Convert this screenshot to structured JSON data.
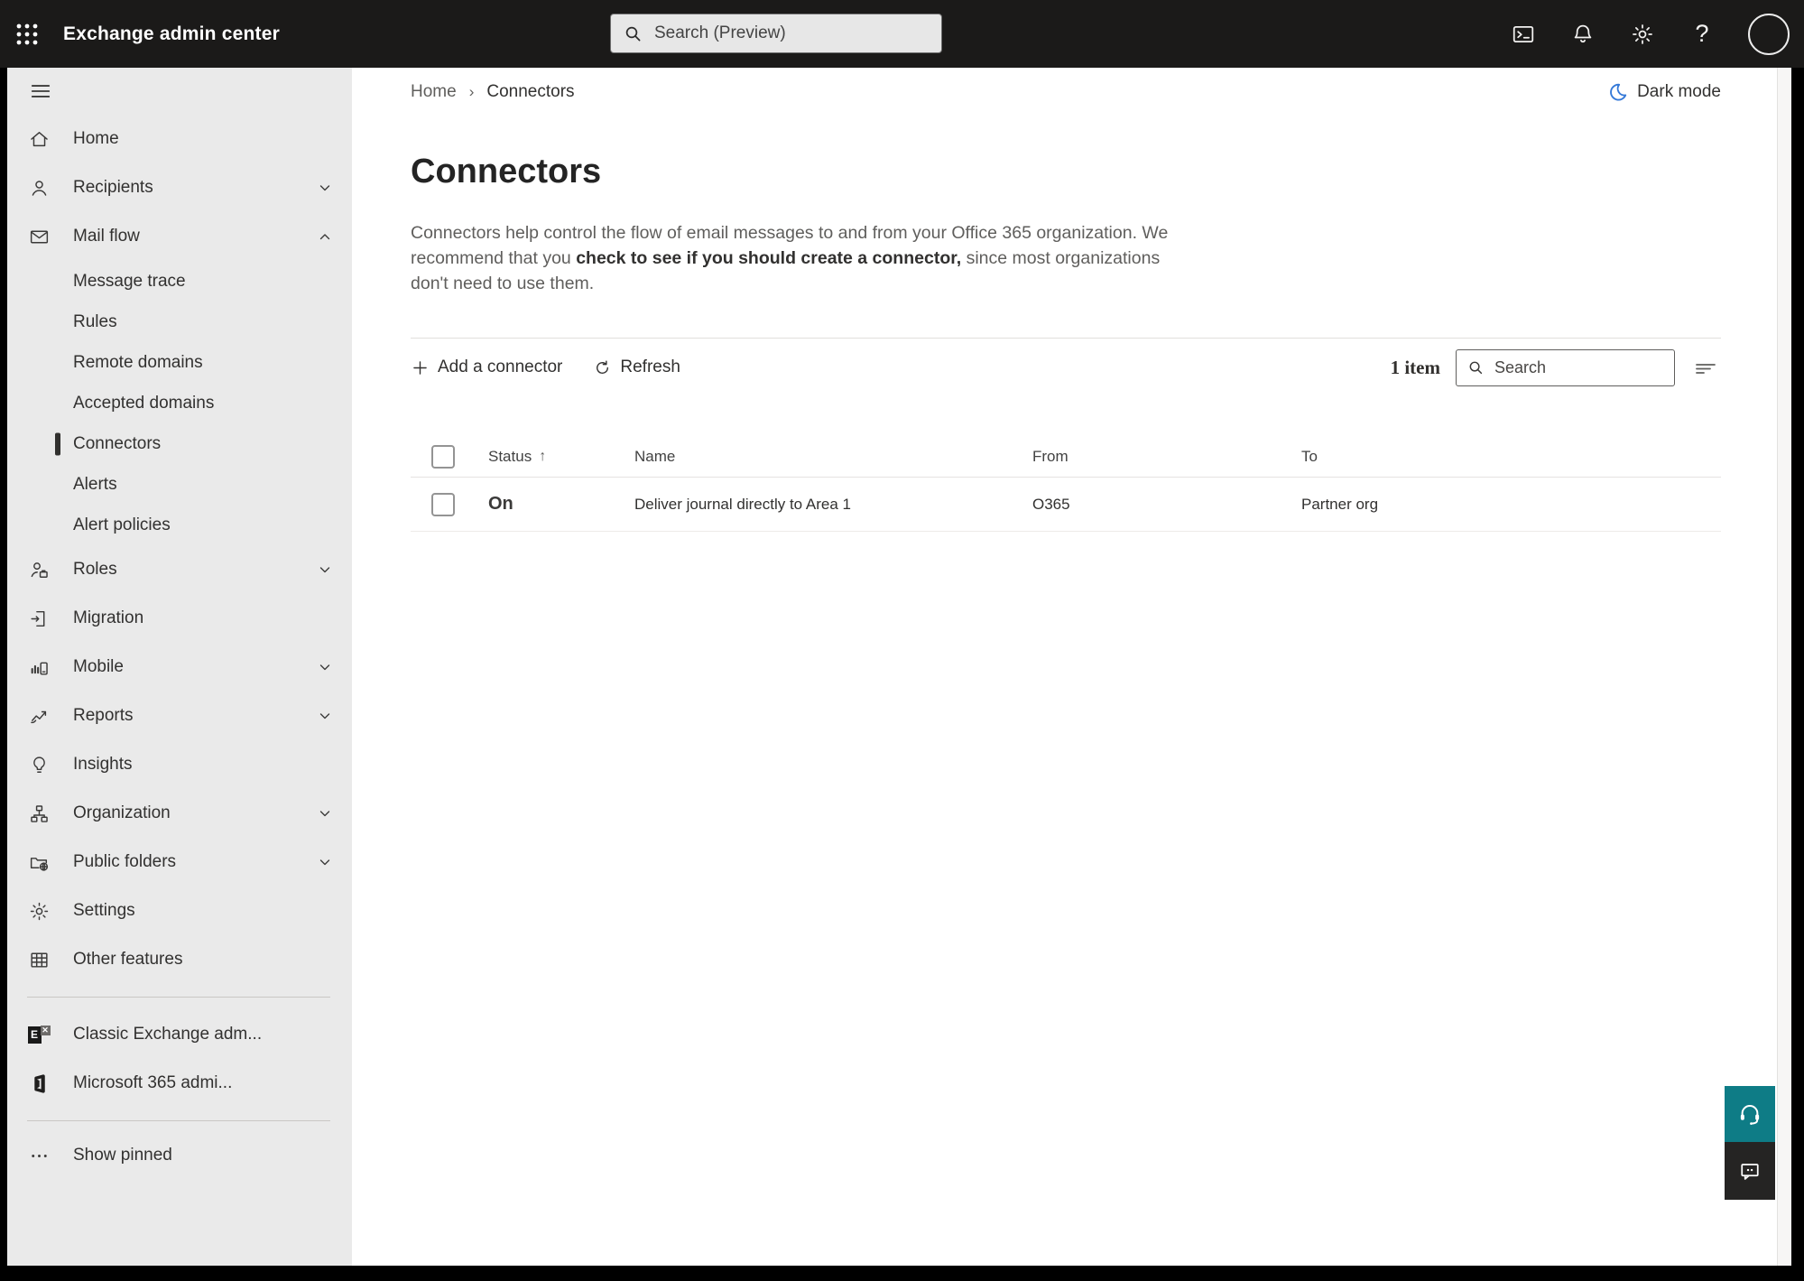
{
  "topbar": {
    "app_title": "Exchange admin center",
    "search_placeholder": "Search (Preview)"
  },
  "breadcrumb": {
    "home": "Home",
    "separator": "›",
    "current": "Connectors"
  },
  "dark_mode": {
    "label": "Dark mode"
  },
  "page": {
    "title": "Connectors",
    "desc_before": "Connectors help control the flow of email messages to and from your Office 365 organization. We recommend that you ",
    "desc_emphasis": "check to see if you should create a connector,",
    "desc_after": " since most organizations don't need to use them."
  },
  "toolbar": {
    "add_label": "Add a connector",
    "refresh_label": "Refresh",
    "item_count": "1 item",
    "search_placeholder": "Search"
  },
  "table": {
    "headers": {
      "status": "Status",
      "name": "Name",
      "from": "From",
      "to": "To"
    },
    "sort_arrow": "↑",
    "rows": [
      {
        "status": "On",
        "name": "Deliver journal directly to Area 1",
        "from": "O365",
        "to": "Partner org"
      }
    ]
  },
  "sidebar": {
    "items": [
      {
        "label": "Home",
        "icon": "home-icon"
      },
      {
        "label": "Recipients",
        "icon": "person-icon",
        "chevron": "down"
      },
      {
        "label": "Mail flow",
        "icon": "mail-icon",
        "chevron": "up",
        "expanded": true
      },
      {
        "label": "Message trace"
      },
      {
        "label": "Rules"
      },
      {
        "label": "Remote domains"
      },
      {
        "label": "Accepted domains"
      },
      {
        "label": "Connectors",
        "selected": true
      },
      {
        "label": "Alerts"
      },
      {
        "label": "Alert policies"
      },
      {
        "label": "Roles",
        "icon": "person-briefcase-icon",
        "chevron": "down"
      },
      {
        "label": "Migration",
        "icon": "document-arrow-icon"
      },
      {
        "label": "Mobile",
        "icon": "mobile-chart-icon",
        "chevron": "down"
      },
      {
        "label": "Reports",
        "icon": "line-chart-icon",
        "chevron": "down"
      },
      {
        "label": "Insights",
        "icon": "lightbulb-icon"
      },
      {
        "label": "Organization",
        "icon": "org-tree-icon",
        "chevron": "down"
      },
      {
        "label": "Public folders",
        "icon": "folder-globe-icon",
        "chevron": "down"
      },
      {
        "label": "Settings",
        "icon": "gear-icon"
      },
      {
        "label": "Other features",
        "icon": "grid-table-icon"
      },
      {
        "label": "Classic Exchange adm...",
        "icon": "classic-exchange-logo"
      },
      {
        "label": "Microsoft 365 admi...",
        "icon": "microsoft-365-logo"
      },
      {
        "label": "Show pinned",
        "icon": "ellipsis-icon"
      }
    ]
  },
  "colors": {
    "topbar_bg": "#1B1A19",
    "sidebar_bg": "#EAEAEA",
    "help_teal": "#0E7C86",
    "feedback_dark": "#252423",
    "moon_blue": "#3579D8"
  }
}
